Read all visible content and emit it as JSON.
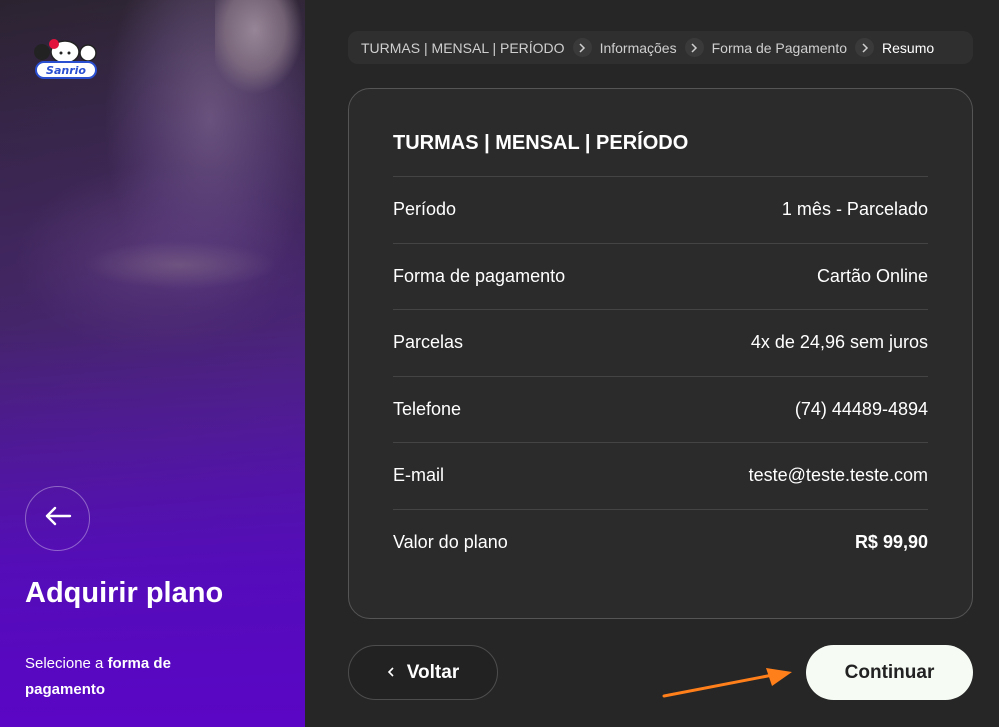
{
  "sidebar": {
    "title": "Adquirir plano",
    "subtitle_prefix": "Selecione a ",
    "subtitle_bold": "forma de pagamento",
    "logo_icon": "hello-kitty-logo-icon",
    "back_icon": "arrow-left-icon"
  },
  "breadcrumb": {
    "items": [
      "TURMAS | MENSAL | PERÍODO",
      "Informações",
      "Forma de Pagamento",
      "Resumo"
    ],
    "active_index": 3,
    "separator_icon": "chevron-right-icon"
  },
  "summary": {
    "title": "TURMAS | MENSAL | PERÍODO",
    "rows": [
      {
        "label": "Período",
        "value": "1 mês - Parcelado"
      },
      {
        "label": "Forma de pagamento",
        "value": "Cartão Online"
      },
      {
        "label": "Parcelas",
        "value": "4x de 24,96 sem juros"
      },
      {
        "label": "Telefone",
        "value": "(74) 44489-4894"
      },
      {
        "label": "E-mail",
        "value": "teste@teste.teste.com"
      },
      {
        "label": "Valor do plano",
        "value": "R$ 99,90"
      }
    ]
  },
  "actions": {
    "back_label": "Voltar",
    "continue_label": "Continuar"
  },
  "colors": {
    "accent_purple": "#5a06c4",
    "annotation_arrow": "#ff7f1a",
    "continue_bg": "#f6fbf4"
  }
}
